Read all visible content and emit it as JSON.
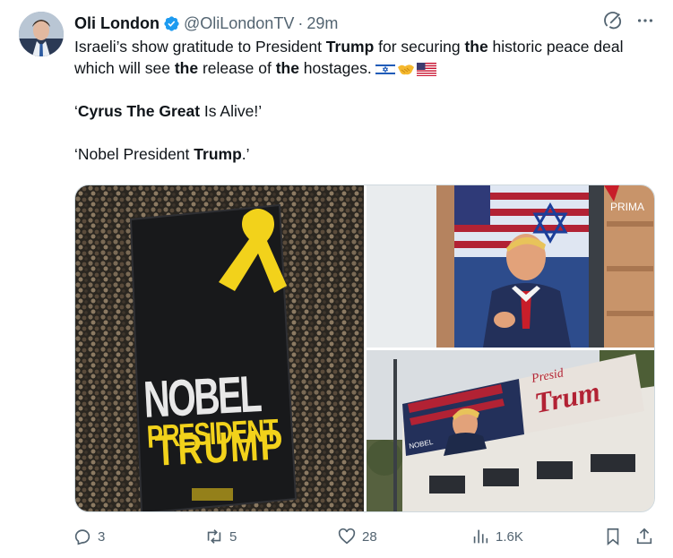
{
  "tweet": {
    "author_name": "Oli London",
    "handle": "@OliLondonTV",
    "separator": "·",
    "time": "29m",
    "text": {
      "p1_a": "Israeli’s show gratitude to President ",
      "p1_b": "Trump",
      "p1_c": " for securing ",
      "p1_d": "the",
      "p1_e": " historic peace deal which will see ",
      "p1_f": "the",
      "p1_g": " release of ",
      "p1_h": "the",
      "p1_i": " hostages.",
      "p2_a": "‘",
      "p2_b": "Cyrus The Great",
      "p2_c": " Is Alive!’",
      "p3_a": "‘Nobel President ",
      "p3_b": "Trump",
      "p3_c": ".’"
    },
    "emojis": [
      "israel-flag",
      "handshake",
      "us-flag"
    ]
  },
  "media": {
    "banner_line1": "NOBEL",
    "banner_line2": "PRESIDENT",
    "banner_line3": "TRUMP",
    "billboard_top_sign": "PRIMA",
    "billboard_bottom_text1": "Presid",
    "billboard_bottom_text2": "Trum",
    "billboard_small": "NOBEL"
  },
  "actions": {
    "replies": "3",
    "reposts": "5",
    "likes": "28",
    "views": "1.6K"
  },
  "icons": {
    "verified": "verified-badge-icon",
    "grok": "grok-icon",
    "more": "more-icon",
    "reply": "reply-icon",
    "repost": "repost-icon",
    "like": "heart-icon",
    "views": "views-icon",
    "bookmark": "bookmark-icon",
    "share": "share-icon"
  },
  "colors": {
    "text": "#0f1419",
    "muted": "#536471",
    "verified": "#1d9bf0",
    "banner_yellow": "#f2d21b"
  }
}
